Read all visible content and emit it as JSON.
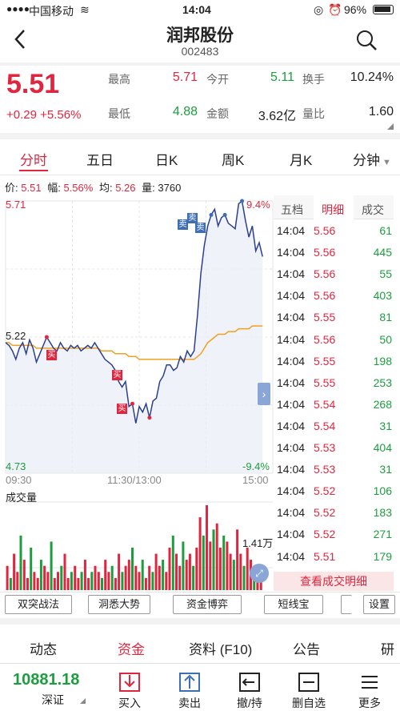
{
  "status_bar": {
    "carrier": "中国移动",
    "time": "14:04",
    "battery": "96%"
  },
  "nav": {
    "title": "润邦股份",
    "code": "002483"
  },
  "quote": {
    "price": "5.51",
    "change": "+0.29 +5.56%",
    "fields": [
      {
        "label": "最高",
        "value": "5.71",
        "tone": "red"
      },
      {
        "label": "今开",
        "value": "5.11",
        "tone": "green"
      },
      {
        "label": "换手",
        "value": "10.24%",
        "tone": "plain"
      },
      {
        "label": "最低",
        "value": "4.88",
        "tone": "green"
      },
      {
        "label": "金额",
        "value": "3.62亿",
        "tone": "plain"
      },
      {
        "label": "量比",
        "value": "1.60",
        "tone": "plain"
      }
    ]
  },
  "tabs": [
    "分时",
    "五日",
    "日K",
    "周K",
    "月K",
    "分钟"
  ],
  "info": {
    "price_label": "价:",
    "price": "5.51",
    "amp_label": "幅:",
    "amp": "5.56%",
    "avg_label": "均:",
    "avg": "5.26",
    "vol_label": "量:",
    "vol": "3760"
  },
  "chart_labels": {
    "y_top": "5.71",
    "y_mid": "5.22",
    "y_bottom": "4.73",
    "pct_top": "9.4%",
    "pct_bottom": "-9.4%",
    "x_start": "09:30",
    "x_mid": "11:30/13:00",
    "x_end": "15:00",
    "volume_title": "成交量",
    "volume_max": "1.41万",
    "buy_label": "买",
    "sell_label": "卖"
  },
  "chart_data": {
    "type": "line",
    "ylim": [
      4.73,
      5.71
    ],
    "series": [
      {
        "values": [
          5.2,
          5.19,
          5.17,
          5.14,
          5.18,
          5.2,
          5.16,
          5.21,
          5.18,
          5.13,
          5.16,
          5.19,
          5.22,
          5.2,
          5.18,
          5.17,
          5.2,
          5.18,
          5.17,
          5.19,
          5.18,
          5.19,
          5.17,
          5.18,
          5.19,
          5.18,
          5.2,
          5.18,
          5.16,
          5.14,
          5.13,
          5.12,
          5.1,
          5.06,
          5.04,
          5.06,
          4.97,
          4.98,
          4.91,
          4.97,
          4.95,
          4.98,
          4.93,
          4.99,
          5.0,
          5.06,
          5.08,
          5.12,
          5.12,
          5.1,
          5.11,
          5.15,
          5.13,
          5.17,
          5.15,
          5.17,
          5.3,
          5.45,
          5.55,
          5.62,
          5.66,
          5.68,
          5.62,
          5.65,
          5.66,
          5.63,
          5.62,
          5.61,
          5.7,
          5.71,
          5.64,
          5.58,
          5.62,
          5.53,
          5.56,
          5.51
        ]
      },
      {
        "values": [
          5.2,
          5.2,
          5.19,
          5.19,
          5.19,
          5.19,
          5.19,
          5.19,
          5.19,
          5.18,
          5.18,
          5.18,
          5.18,
          5.18,
          5.18,
          5.18,
          5.18,
          5.18,
          5.18,
          5.18,
          5.18,
          5.18,
          5.18,
          5.18,
          5.18,
          5.18,
          5.18,
          5.18,
          5.17,
          5.17,
          5.17,
          5.17,
          5.16,
          5.16,
          5.16,
          5.16,
          5.15,
          5.15,
          5.15,
          5.14,
          5.14,
          5.14,
          5.14,
          5.14,
          5.14,
          5.14,
          5.14,
          5.14,
          5.14,
          5.14,
          5.14,
          5.14,
          5.14,
          5.14,
          5.14,
          5.14,
          5.15,
          5.16,
          5.18,
          5.2,
          5.21,
          5.22,
          5.23,
          5.23,
          5.23,
          5.24,
          5.24,
          5.24,
          5.25,
          5.25,
          5.25,
          5.25,
          5.26,
          5.26,
          5.26,
          5.26
        ]
      }
    ],
    "volumes": [
      4,
      2,
      6,
      3,
      9,
      5,
      2,
      7,
      3,
      2,
      5,
      4,
      3,
      8,
      2,
      3,
      4,
      6,
      2,
      3,
      4,
      2,
      3,
      5,
      2,
      3,
      4,
      3,
      2,
      5,
      3,
      4,
      2,
      6,
      3,
      4,
      5,
      7,
      4,
      3,
      5,
      2,
      4,
      3,
      6,
      4,
      5,
      3,
      7,
      9,
      6,
      4,
      8,
      5,
      6,
      4,
      7,
      12,
      9,
      14,
      8,
      10,
      11,
      7,
      9,
      8,
      6,
      5,
      10,
      6,
      4,
      7,
      5,
      4,
      3,
      4
    ]
  },
  "right_panel": {
    "tabs": [
      "五档",
      "明细",
      "成交"
    ],
    "rows": [
      {
        "time": "14:04",
        "price": "5.56",
        "volume": "61"
      },
      {
        "time": "14:04",
        "price": "5.56",
        "volume": "445"
      },
      {
        "time": "14:04",
        "price": "5.56",
        "volume": "55"
      },
      {
        "time": "14:04",
        "price": "5.56",
        "volume": "403"
      },
      {
        "time": "14:04",
        "price": "5.55",
        "volume": "81"
      },
      {
        "time": "14:04",
        "price": "5.56",
        "volume": "50"
      },
      {
        "time": "14:04",
        "price": "5.55",
        "volume": "198"
      },
      {
        "time": "14:04",
        "price": "5.55",
        "volume": "253"
      },
      {
        "time": "14:04",
        "price": "5.54",
        "volume": "268"
      },
      {
        "time": "14:04",
        "price": "5.54",
        "volume": "31"
      },
      {
        "time": "14:04",
        "price": "5.53",
        "volume": "404"
      },
      {
        "time": "14:04",
        "price": "5.53",
        "volume": "31"
      },
      {
        "time": "14:04",
        "price": "5.52",
        "volume": "106"
      },
      {
        "time": "14:04",
        "price": "5.52",
        "volume": "183"
      },
      {
        "time": "14:04",
        "price": "5.52",
        "volume": "271"
      },
      {
        "time": "14:04",
        "price": "5.51",
        "volume": "179"
      }
    ],
    "view_all": "查看成交明细"
  },
  "tools": [
    "双突战法",
    "洞悉大势",
    "资金博弈",
    "短线宝",
    "设置"
  ],
  "section_tabs": [
    "动态",
    "资金",
    "资料 (F10)",
    "公告",
    "研报"
  ],
  "index": {
    "value": "10881.18",
    "name": "深证"
  },
  "bottom_actions": [
    "买入",
    "卖出",
    "撤/持",
    "删自选",
    "更多"
  ],
  "colors": {
    "up": "#e0263f",
    "down": "#1c9e3e",
    "price_line": "#2b3f8f",
    "avg_line": "#f0a020"
  }
}
